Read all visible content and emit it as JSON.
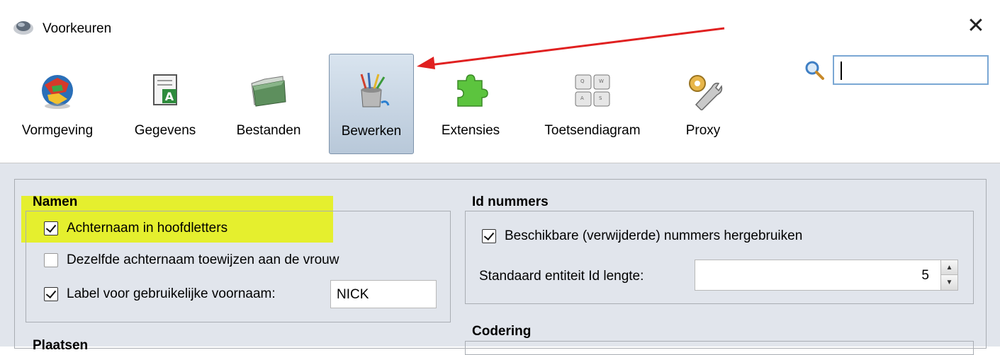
{
  "window": {
    "title": "Voorkeuren",
    "close_label": "✕"
  },
  "toolbar": {
    "items": [
      {
        "label": "Vormgeving",
        "icon": "globe-icon",
        "active": false
      },
      {
        "label": "Gegevens",
        "icon": "document-icon",
        "active": false
      },
      {
        "label": "Bestanden",
        "icon": "folder-icon",
        "active": false
      },
      {
        "label": "Bewerken",
        "icon": "paint-brushes-icon",
        "active": true
      },
      {
        "label": "Extensies",
        "icon": "puzzle-icon",
        "active": false
      },
      {
        "label": "Toetsendiagram",
        "icon": "keyboard-icon",
        "active": false
      },
      {
        "label": "Proxy",
        "icon": "gear-wrench-icon",
        "active": false
      }
    ]
  },
  "search": {
    "value": "",
    "placeholder": ""
  },
  "namen": {
    "title": "Namen",
    "achternaam_hoofdletters": {
      "label": "Achternaam in hoofdletters",
      "checked": true
    },
    "dezelfde_achternaam": {
      "label": "Dezelfde achternaam toewijzen aan de vrouw",
      "checked": false
    },
    "label_voornaam": {
      "label": "Label voor gebruikelijke voornaam:",
      "checked": true,
      "value": "NICK"
    }
  },
  "plaatsen": {
    "title": "Plaatsen"
  },
  "id_nummers": {
    "title": "Id nummers",
    "hergebruiken": {
      "label": "Beschikbare (verwijderde) nummers hergebruiken",
      "checked": true
    },
    "lengte": {
      "label": "Standaard entiteit Id lengte:",
      "value": "5"
    }
  },
  "codering": {
    "title": "Codering"
  },
  "annotations": {
    "arrow_color": "#e02020",
    "highlight_color": "#e6ef1a"
  }
}
